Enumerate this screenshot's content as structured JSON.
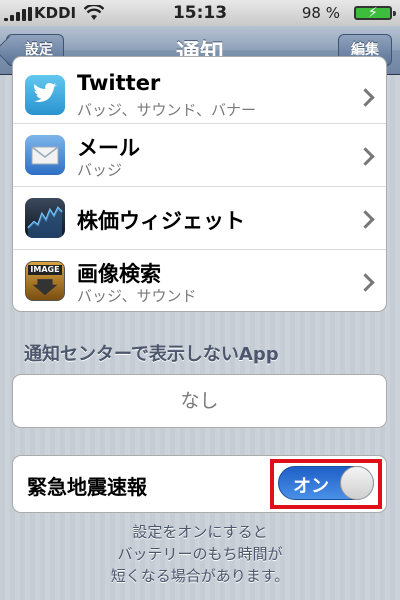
{
  "status_bar": {
    "carrier": "KDDI",
    "time": "15:13",
    "battery_text": "98 %"
  },
  "nav": {
    "back_label": "設定",
    "title": "通知",
    "edit_label": "編集"
  },
  "apps": [
    {
      "name": "Twitter",
      "subtitle": "バッジ、サウンド、バナー",
      "icon": "twitter-bird-icon"
    },
    {
      "name": "メール",
      "subtitle": "バッジ",
      "icon": "mail-envelope-icon"
    },
    {
      "name": "株価ウィジェット",
      "subtitle": "",
      "icon": "stocks-chart-icon"
    },
    {
      "name": "画像検索",
      "subtitle": "バッジ、サウンド",
      "icon": "image-search-icon",
      "icon_text": "IMAGE"
    }
  ],
  "not_in_center": {
    "header": "通知センターで表示しないApp",
    "value": "なし"
  },
  "earthquake": {
    "label": "緊急地震速報",
    "toggle_label": "オン",
    "enabled": true
  },
  "footer_lines": [
    "設定をオンにすると",
    "バッテリーのもち時間が",
    "短くなる場合があります。"
  ],
  "colors": {
    "nav_bar": "#7f94ad",
    "toggle_on": "#2f77d8",
    "highlight": "#e0101a",
    "section_text": "#4c566c"
  }
}
